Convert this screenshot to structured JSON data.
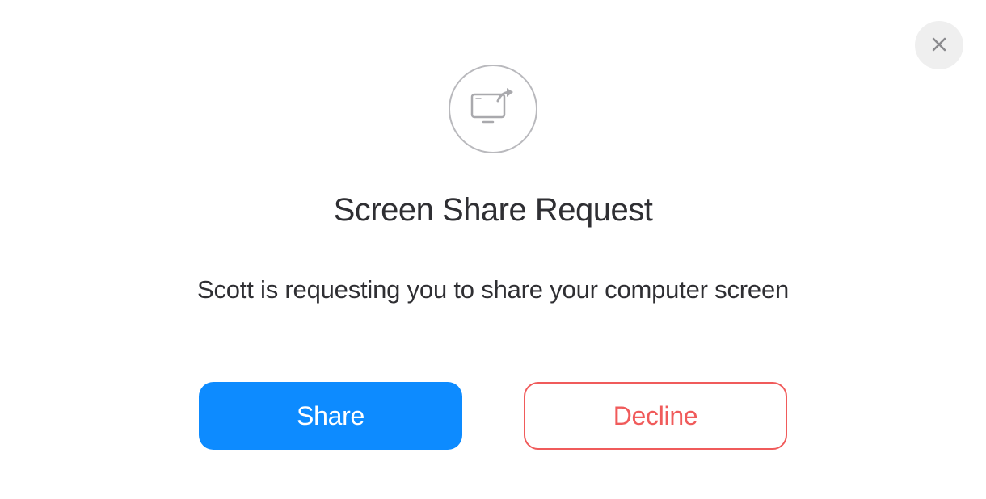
{
  "dialog": {
    "title": "Screen Share Request",
    "message": "Scott is requesting you to share your computer screen",
    "buttons": {
      "share": "Share",
      "decline": "Decline"
    }
  },
  "colors": {
    "primary": "#0d8bff",
    "danger": "#f05b5b",
    "closeBg": "#efefef",
    "iconBorder": "#b9b9bd",
    "text": "#2f2f33"
  },
  "icons": {
    "close": "close-icon",
    "screenShare": "screen-share-icon"
  }
}
